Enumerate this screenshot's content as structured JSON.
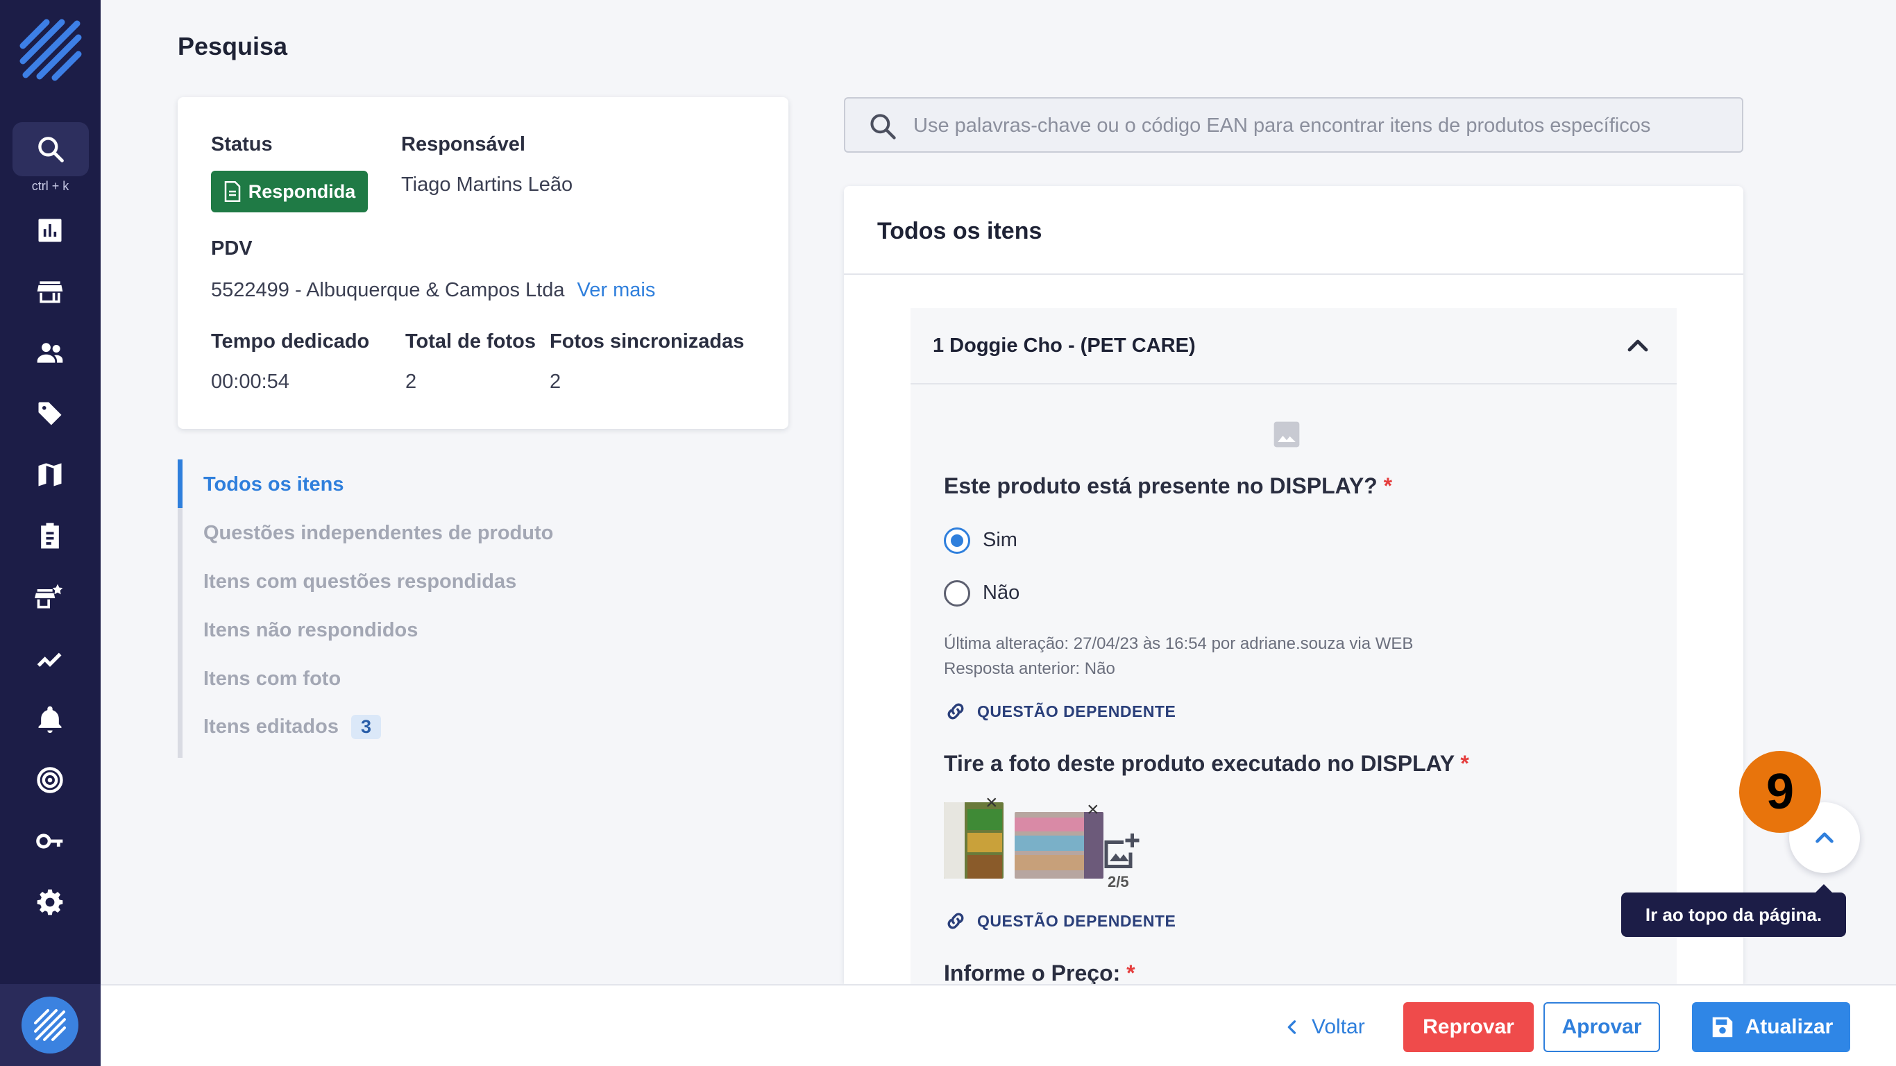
{
  "sidebar": {
    "shortcut": "ctrl + k",
    "nav_icons": [
      "search-icon",
      "chart-icon",
      "store-icon",
      "users-icon",
      "tag-icon",
      "map-icon",
      "clipboard-icon",
      "store-star-icon",
      "trend-icon",
      "bell-icon",
      "target-icon",
      "key-icon",
      "gear-icon"
    ]
  },
  "page": {
    "title": "Pesquisa"
  },
  "info": {
    "status_label": "Status",
    "status_value": "Respondida",
    "responsible_label": "Responsável",
    "responsible_value": "Tiago Martins Leão",
    "pdv_label": "PDV",
    "pdv_value": "5522499 - Albuquerque & Campos Ltda",
    "pdv_link": "Ver mais",
    "time_label": "Tempo dedicado",
    "time_value": "00:00:54",
    "photos_label": "Total de fotos",
    "photos_value": "2",
    "synced_label": "Fotos sincronizadas",
    "synced_value": "2"
  },
  "filters": {
    "items": [
      {
        "label": "Todos os itens",
        "active": true
      },
      {
        "label": "Questões independentes de produto"
      },
      {
        "label": "Itens com questões respondidas"
      },
      {
        "label": "Itens não respondidos"
      },
      {
        "label": "Itens com foto"
      },
      {
        "label": "Itens editados",
        "count": "3"
      }
    ]
  },
  "search": {
    "placeholder": "Use palavras-chave ou o código EAN para encontrar itens de produtos específicos"
  },
  "items_panel": {
    "title": "Todos os itens",
    "product": {
      "title": "1 Doggie Cho - (PET CARE)",
      "q1": {
        "text": "Este produto está presente no DISPLAY?",
        "required": "*",
        "options": [
          "Sim",
          "Não"
        ],
        "selected": "Sim",
        "last_change": "Última alteração: 27/04/23 às 16:54 por adriane.souza via WEB",
        "previous": "Resposta anterior:  Não"
      },
      "dependent_label": "QUESTÃO DEPENDENTE",
      "q2": {
        "text": "Tire a foto deste produto executado no DISPLAY",
        "required": "*",
        "photo_count": "2/5",
        "remove_symbol": "×"
      },
      "q3": {
        "text": "Informe o Preço:",
        "required": "*"
      }
    }
  },
  "footer": {
    "back": "Voltar",
    "reject": "Reprovar",
    "approve": "Aprovar",
    "update": "Atualizar"
  },
  "scroll_top": {
    "tooltip": "Ir ao topo da página."
  },
  "step_badge": "9",
  "colors": {
    "sidebar": "#1c1d47",
    "accent": "#2f7fdc",
    "status_green": "#1f7a45",
    "reject_red": "#ef4b4b",
    "step_orange": "#e8740c"
  }
}
